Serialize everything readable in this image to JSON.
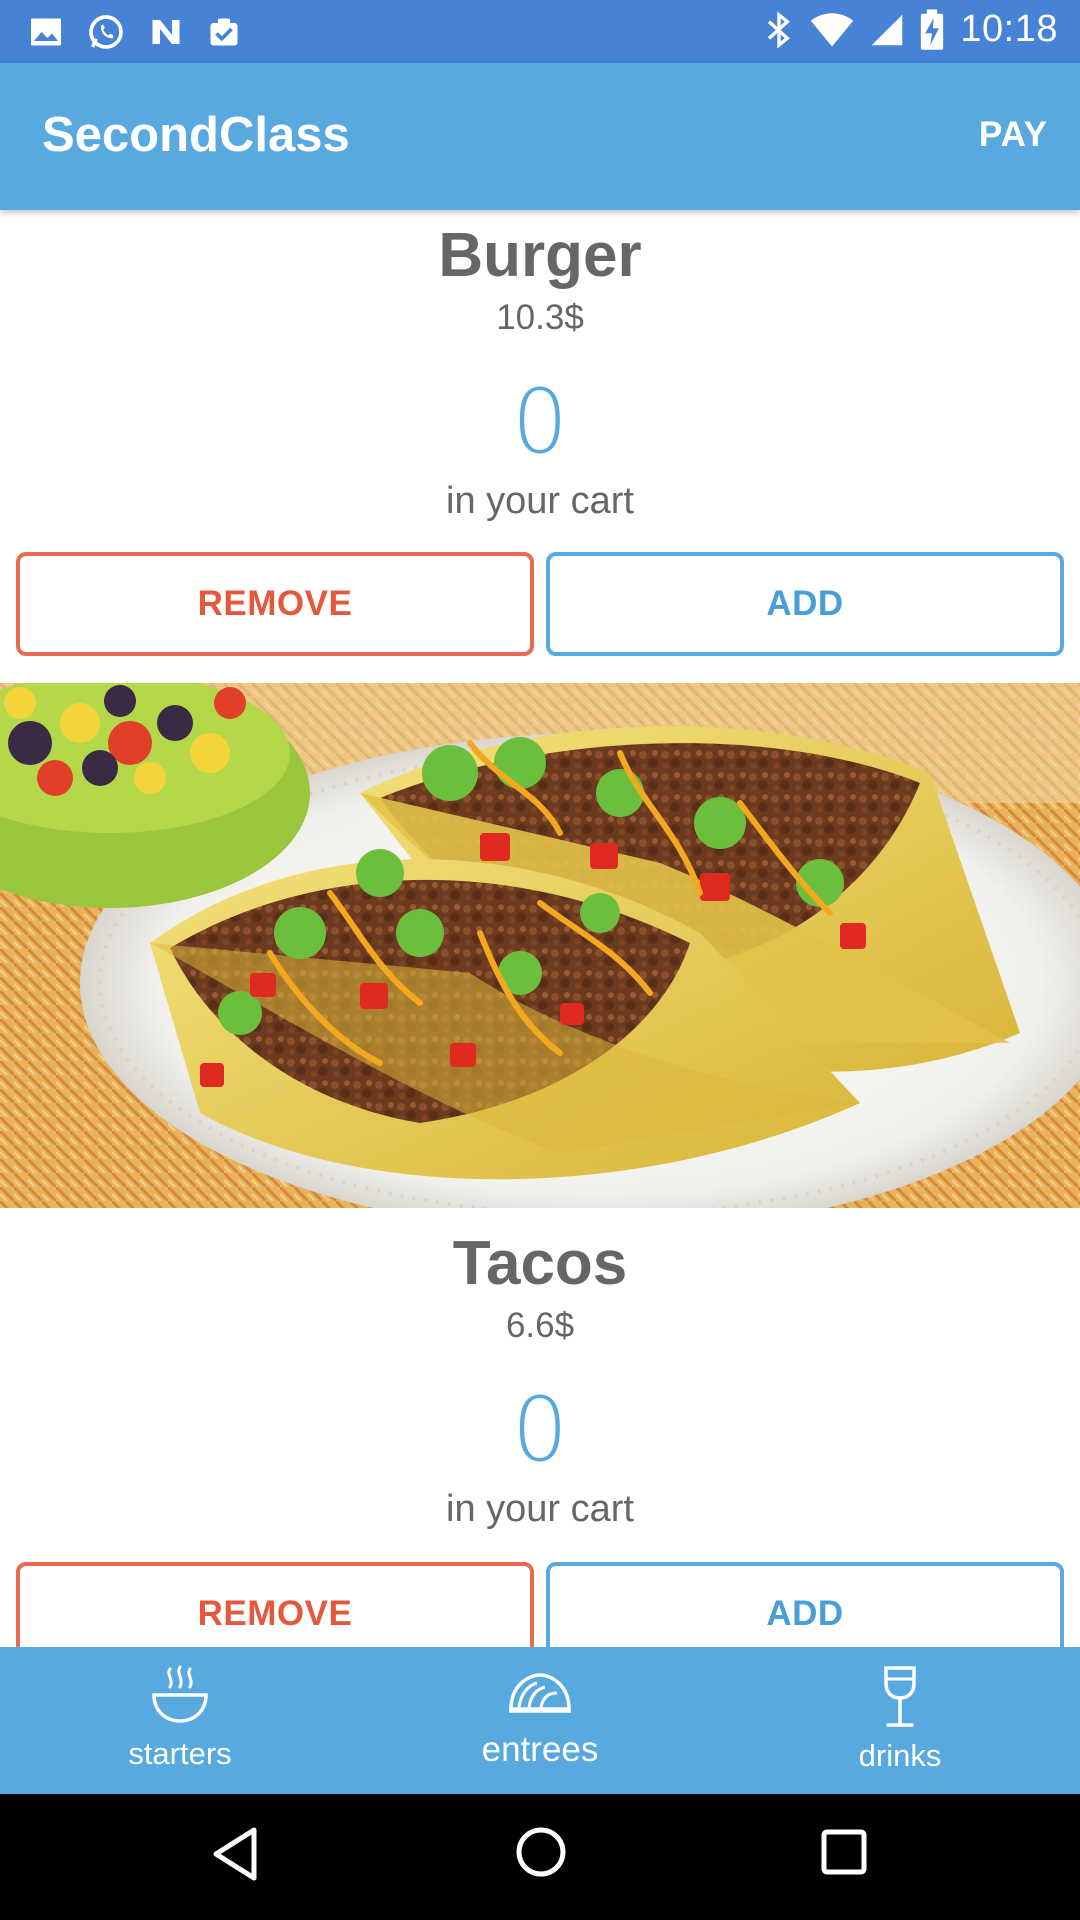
{
  "status_bar": {
    "time": "10:18",
    "left_icons": [
      "image-icon",
      "whatsapp-icon",
      "n-app-icon",
      "clipboard-check-icon"
    ],
    "right_icons": [
      "bluetooth-icon",
      "wifi-icon",
      "cell-signal-icon",
      "battery-charging-icon"
    ]
  },
  "app_bar": {
    "title": "SecondClass",
    "action_label": "PAY",
    "color": "#58a9e0"
  },
  "items": [
    {
      "name": "Burger",
      "price": "10.3$",
      "count": "0",
      "cart_label": "in your cart",
      "remove_label": "REMOVE",
      "add_label": "ADD"
    },
    {
      "name": "Tacos",
      "price": "6.6$",
      "count": "0",
      "cart_label": "in your cart",
      "remove_label": "REMOVE",
      "add_label": "ADD",
      "image": "tacos-photo"
    }
  ],
  "bottom_nav": {
    "items": [
      {
        "label": "starters",
        "icon": "soup-bowl-icon"
      },
      {
        "label": "entrees",
        "icon": "taco-icon",
        "active": true
      },
      {
        "label": "drinks",
        "icon": "wine-glass-icon"
      }
    ]
  },
  "system_nav": {
    "icons": [
      "back-icon",
      "home-icon",
      "recents-icon"
    ]
  },
  "colors": {
    "status_bar": "#4682d6",
    "primary": "#58a9e0",
    "remove": "#e86a4e"
  }
}
